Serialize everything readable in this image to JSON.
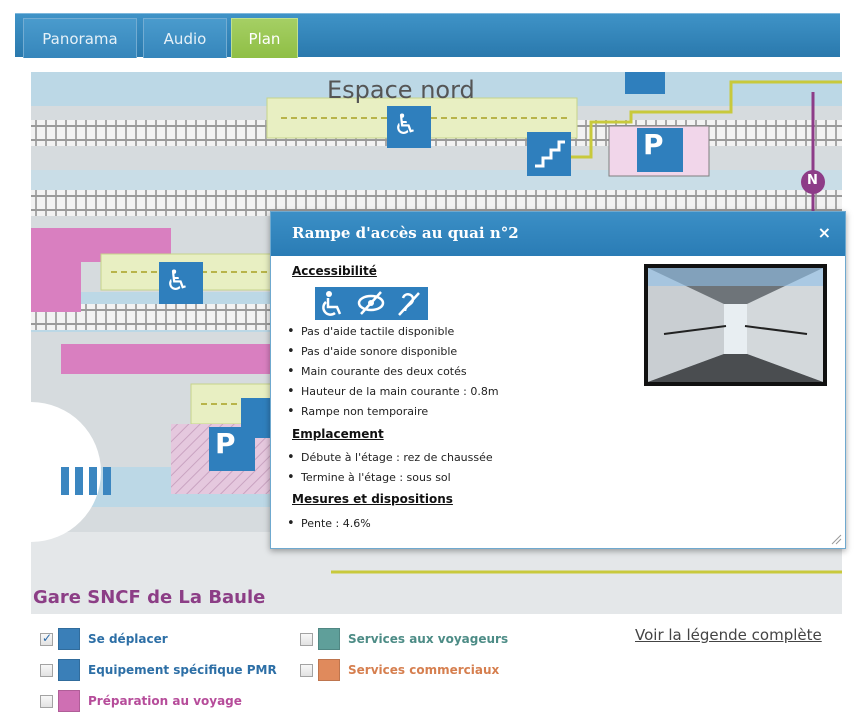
{
  "tabs": [
    {
      "label": "Panorama",
      "active": false
    },
    {
      "label": "Audio",
      "active": false
    },
    {
      "label": "Plan",
      "active": true
    }
  ],
  "map": {
    "zone_label": "Espace nord",
    "north_label": "N",
    "parking_label": "P",
    "station_name": "Gare SNCF de La Baule"
  },
  "popup": {
    "title": "Rampe d'accès au quai n°2",
    "close_label": "×",
    "sections": [
      {
        "heading": "Accessibilité",
        "items": [
          "Pas d'aide tactile disponible",
          "Pas d'aide sonore disponible",
          "Main courante des deux cotés",
          "Hauteur de la main courante : 0.8m",
          "Rampe non temporaire"
        ]
      },
      {
        "heading": "Emplacement",
        "items": [
          "Débute à l'étage : rez de chaussée",
          "Termine à l'étage : sous sol"
        ]
      },
      {
        "heading": "Mesures et dispositions",
        "items": [
          "Pente : 4.6%"
        ]
      }
    ],
    "accessibility_icons": [
      "wheelchair-icon",
      "visual-impairment-icon",
      "hearing-impairment-icon"
    ]
  },
  "legend": {
    "items": [
      {
        "label": "Se déplacer",
        "checked": true,
        "color": "#3a7fb8",
        "label_color": "#2d6fa6"
      },
      {
        "label": "Equipement spécifique PMR",
        "checked": false,
        "color": "#3a7fb8",
        "label_color": "#2d6fa6"
      },
      {
        "label": "Préparation au voyage",
        "checked": false,
        "color": "#cf6fb3",
        "label_color": "#b64c9a"
      },
      {
        "label": "Services aux voyageurs",
        "checked": false,
        "color": "#5f9f9a",
        "label_color": "#4d8c86"
      },
      {
        "label": "Services commerciaux",
        "checked": false,
        "color": "#e08a5c",
        "label_color": "#d67f4f"
      }
    ],
    "full_legend_link": "Voir la légende complète"
  },
  "colors": {
    "tab_bar": "#2f80b6",
    "tab_active": "#9ac756",
    "popup_header": "#3388c2",
    "station_title": "#8c3e86",
    "walkway": "#e8efc2",
    "track": "#bcd8e6"
  }
}
